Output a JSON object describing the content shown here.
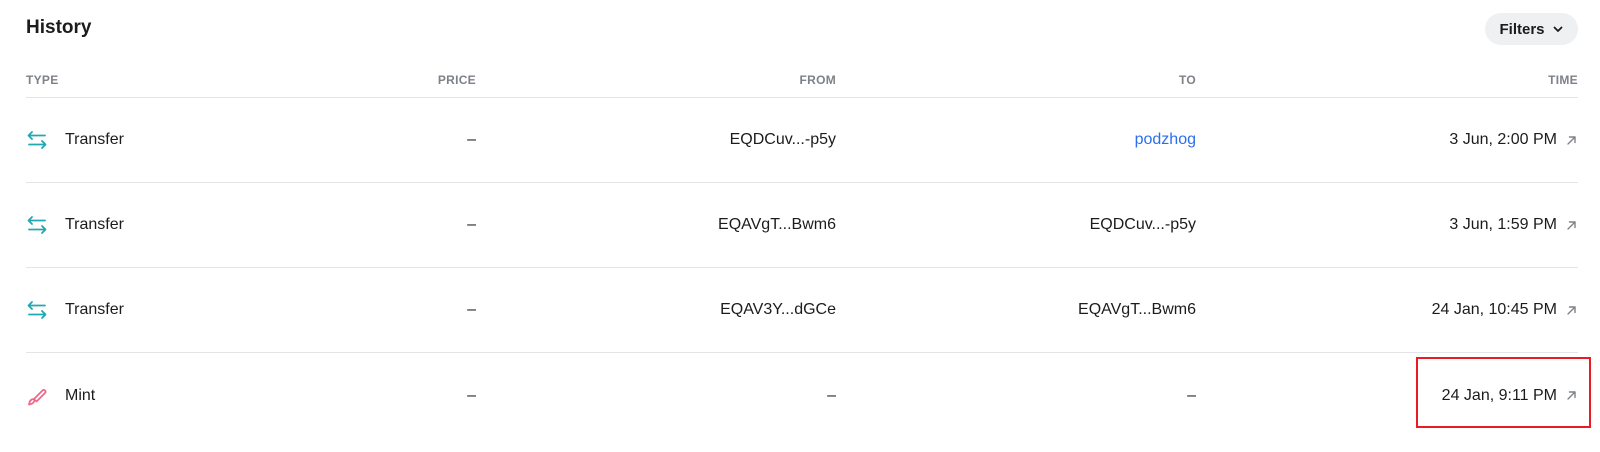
{
  "header": {
    "title": "History",
    "filters_label": "Filters"
  },
  "columns": {
    "type": "TYPE",
    "price": "PRICE",
    "from": "FROM",
    "to": "TO",
    "time": "TIME"
  },
  "rows": [
    {
      "type": "Transfer",
      "icon": "transfer-icon",
      "price": "–",
      "from": "EQDCuv...-p5y",
      "to": "podzhog",
      "to_is_link": true,
      "time": "3 Jun, 2:00 PM"
    },
    {
      "type": "Transfer",
      "icon": "transfer-icon",
      "price": "–",
      "from": "EQAVgT...Bwm6",
      "to": "EQDCuv...-p5y",
      "to_is_link": false,
      "time": "3 Jun, 1:59 PM"
    },
    {
      "type": "Transfer",
      "icon": "transfer-icon",
      "price": "–",
      "from": "EQAV3Y...dGCe",
      "to": "EQAVgT...Bwm6",
      "to_is_link": false,
      "time": "24 Jan, 10:45 PM"
    },
    {
      "type": "Mint",
      "icon": "mint-brush-icon",
      "price": "–",
      "from": "–",
      "to": "–",
      "to_is_link": false,
      "time": "24 Jan, 9:11 PM"
    }
  ],
  "colors": {
    "transfer_icon": "#22a8b3",
    "mint_icon": "#f0668a",
    "link": "#2b6ef0",
    "highlight": "#ea1c23"
  }
}
